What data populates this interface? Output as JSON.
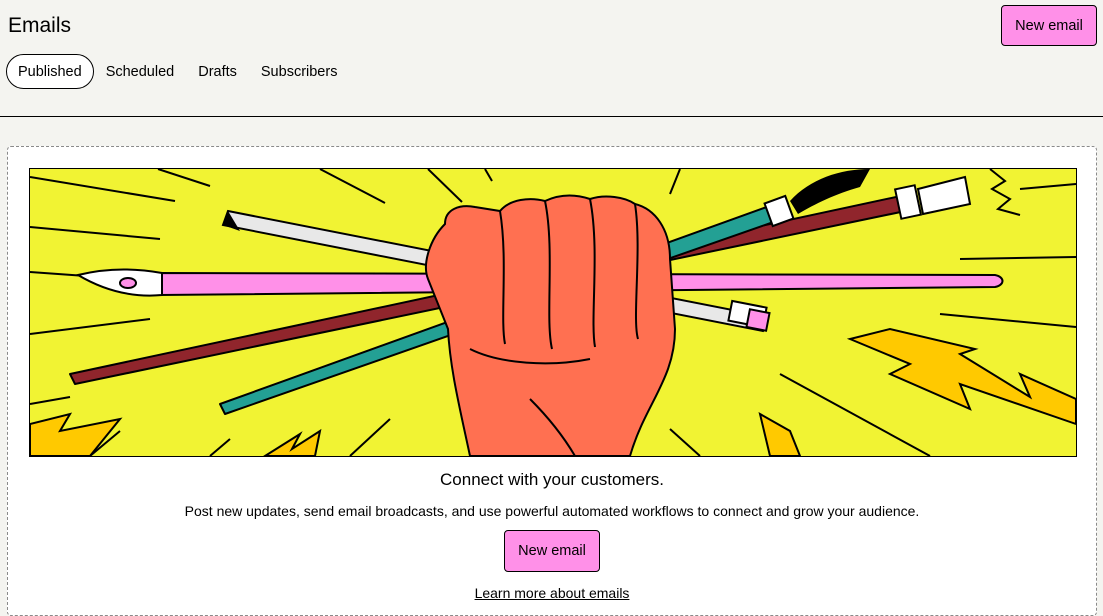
{
  "header": {
    "title": "Emails",
    "new_button_label": "New email"
  },
  "tabs": [
    {
      "label": "Published",
      "active": true
    },
    {
      "label": "Scheduled",
      "active": false
    },
    {
      "label": "Drafts",
      "active": false
    },
    {
      "label": "Subscribers",
      "active": false
    }
  ],
  "empty_state": {
    "illustration": "fist-holding-pencils-and-brushes",
    "heading": "Connect with your customers.",
    "description": "Post new updates, send email broadcasts, and use powerful automated workflows to connect and grow your audience.",
    "new_button_label": "New email",
    "learn_link": "Learn more about emails"
  },
  "colors": {
    "accent_pink": "#ff90e8",
    "page_background": "#f4f4f0",
    "illustration_background": "#f1f333",
    "fist": "#ff7051",
    "teal": "#23a094",
    "maroon": "#90252c",
    "bolt": "#ffc900"
  }
}
